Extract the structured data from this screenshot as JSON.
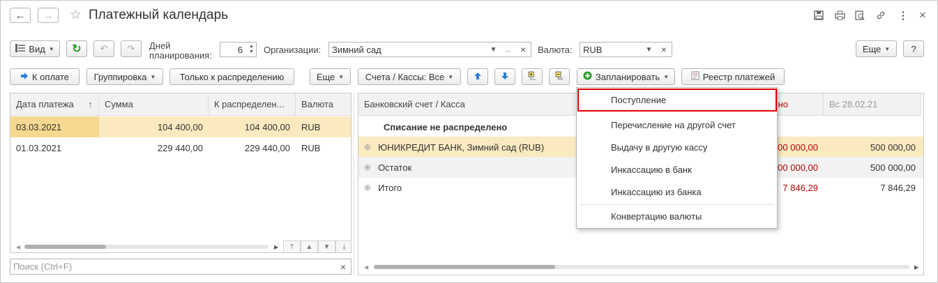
{
  "window": {
    "title": "Платежный календарь"
  },
  "toolbar": {
    "view_label": "Вид",
    "days_label_line1": "Дней",
    "days_label_line2": "планирования:",
    "days_value": "6",
    "org_label": "Организации:",
    "org_value": "Зимний сад",
    "org_dots": "...",
    "clear_x": "×",
    "currency_label": "Валюта:",
    "currency_value": "RUB",
    "more_label": "Еще",
    "help_label": "?"
  },
  "left_panel": {
    "to_pay_label": "К оплате",
    "grouping_label": "Группировка",
    "only_distribution_label": "Только к распределению",
    "more_label": "Еще",
    "columns": [
      "Дата платежа",
      "Сумма",
      "К распределен...",
      "Валюта"
    ],
    "sort_arrow": "↑",
    "rows": [
      {
        "date": "03.03.2021",
        "sum": "104 400,00",
        "to_distribute": "104 400,00",
        "currency": "RUB"
      },
      {
        "date": "01.03.2021",
        "sum": "229 440,00",
        "to_distribute": "229 440,00",
        "currency": "RUB"
      }
    ],
    "search_placeholder": "Поиск (Ctrl+F)",
    "search_clear": "×"
  },
  "right_panel": {
    "accounts_filter_label": "Счета / Кассы: Все",
    "plan_label": "Запланировать",
    "registry_label": "Реестр платежей",
    "columns": {
      "account": "Банковский счет / Касса",
      "col_partial": "но",
      "col_sunday": "Вс 28.02.21"
    },
    "rows": [
      {
        "name": "Списание не распределено",
        "val_partial": "",
        "val_sunday": ""
      },
      {
        "name": "ЮНИКРЕДИТ БАНК, Зимний сад (RUB)",
        "val_partial": "00 000,00",
        "val_sunday": "500 000,00"
      },
      {
        "name": "Остаток",
        "val_partial": "00 000,00",
        "val_sunday": "500 000,00"
      },
      {
        "name": "Итого",
        "val_partial": "7 846,29",
        "val_sunday": "7 846,29"
      }
    ]
  },
  "plan_menu": {
    "items": [
      "Поступление",
      "Перечисление на другой счет",
      "Выдачу в другую кассу",
      "Инкассацию в банк",
      "Инкассацию из банка",
      "Конвертацию валюты"
    ]
  },
  "colors": {
    "selected_row": "#fbeac0",
    "highlight_border": "#e00000",
    "accent_blue": "#2a7fd4",
    "green": "#2a9a2a"
  }
}
